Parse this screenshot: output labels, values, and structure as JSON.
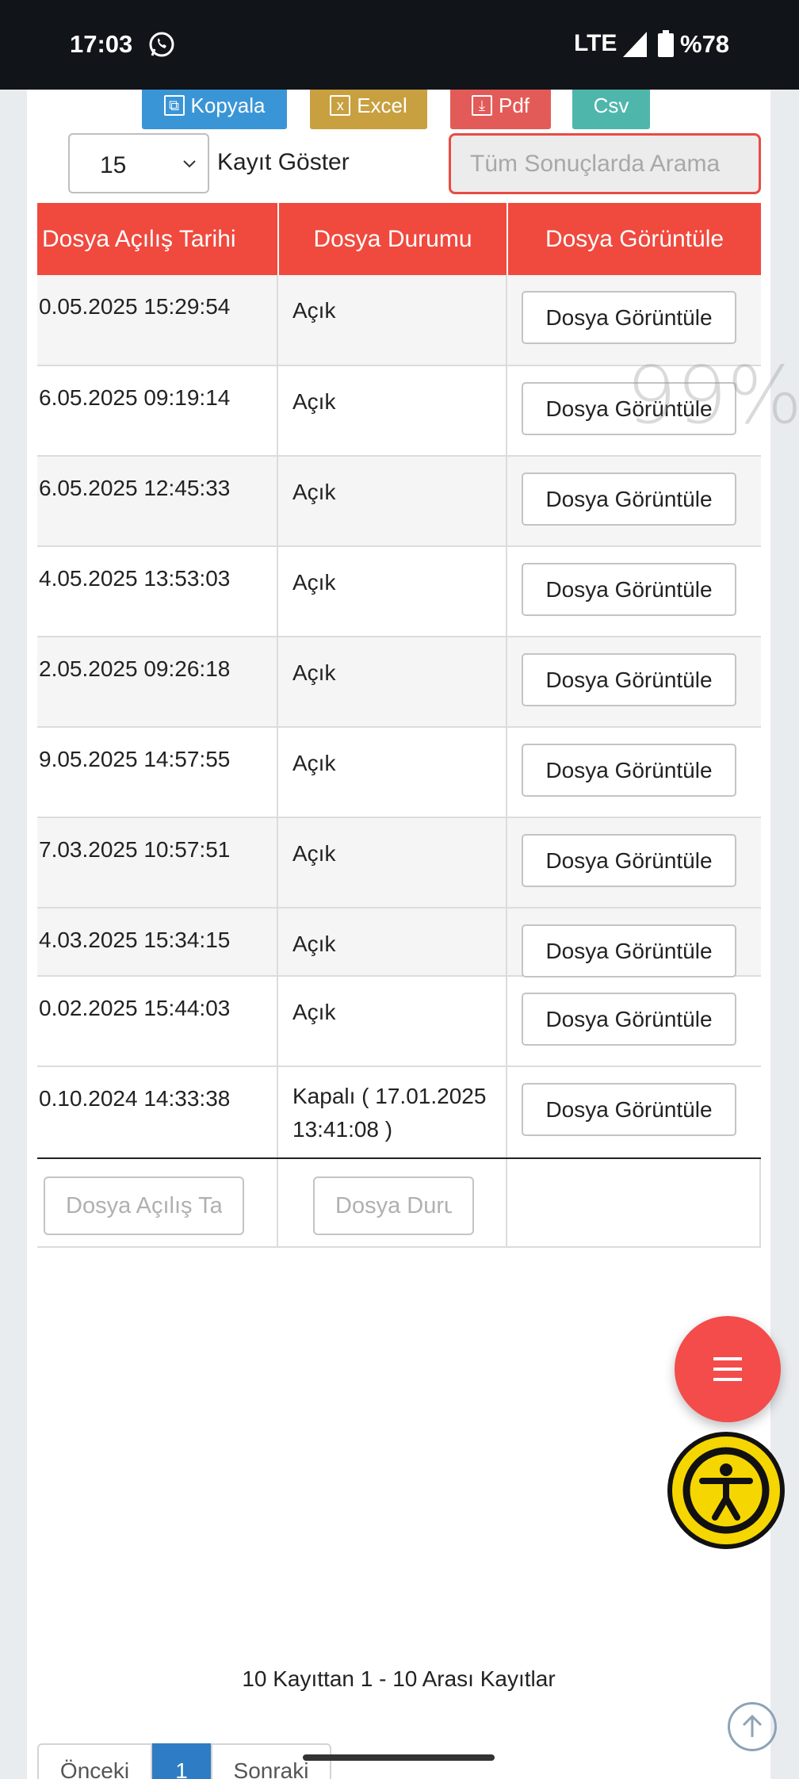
{
  "status_bar": {
    "time": "17:03",
    "network": "LTE",
    "battery": "%78"
  },
  "export": {
    "copy": "Kopyala",
    "excel": "Excel",
    "pdf": "Pdf",
    "csv": "Csv"
  },
  "length": {
    "value": "15",
    "label": "Kayıt Göster"
  },
  "search": {
    "placeholder": "Tüm Sonuçlarda Arama"
  },
  "table": {
    "headers": [
      "Dosya Açılış Tarihi",
      "Dosya Durumu",
      "Dosya Görüntüle"
    ],
    "button_label": "Dosya Görüntüle",
    "rows": [
      {
        "date": "0.05.2025 15:29:54",
        "status": "Açık"
      },
      {
        "date": "6.05.2025 09:19:14",
        "status": "Açık"
      },
      {
        "date": "6.05.2025 12:45:33",
        "status": "Açık"
      },
      {
        "date": "4.05.2025 13:53:03",
        "status": "Açık"
      },
      {
        "date": "2.05.2025 09:26:18",
        "status": "Açık"
      },
      {
        "date": "9.05.2025 14:57:55",
        "status": "Açık"
      },
      {
        "date": "7.03.2025 10:57:51",
        "status": "Açık"
      },
      {
        "date": "4.03.2025 15:34:15",
        "status": "Açık"
      },
      {
        "date": "0.02.2025 15:44:03",
        "status": "Açık"
      },
      {
        "date": "0.10.2024 14:33:38",
        "status": "Kapalı ( 17.01.2025 13:41:08 )"
      }
    ],
    "footer_filters": [
      "Dosya Açılış Tarihi",
      "Dosya Durumu"
    ]
  },
  "info": "10 Kayıttan 1 - 10 Arası Kayıtlar",
  "pagination": {
    "prev": "Önceki",
    "current": "1",
    "next": "Sonraki"
  },
  "overlay": {
    "zoom": "99%"
  },
  "colors": {
    "header_red": "#f0493e",
    "fab_red": "#f44b4b",
    "accessibility_yellow": "#f6d600",
    "page_active": "#2d7cc4"
  },
  "icons": [
    "whatsapp-icon",
    "signal-icon",
    "battery-icon",
    "copy-icon",
    "excel-icon",
    "pdf-icon",
    "chevron-down-icon",
    "menu-icon",
    "accessibility-icon",
    "arrow-up-icon"
  ]
}
